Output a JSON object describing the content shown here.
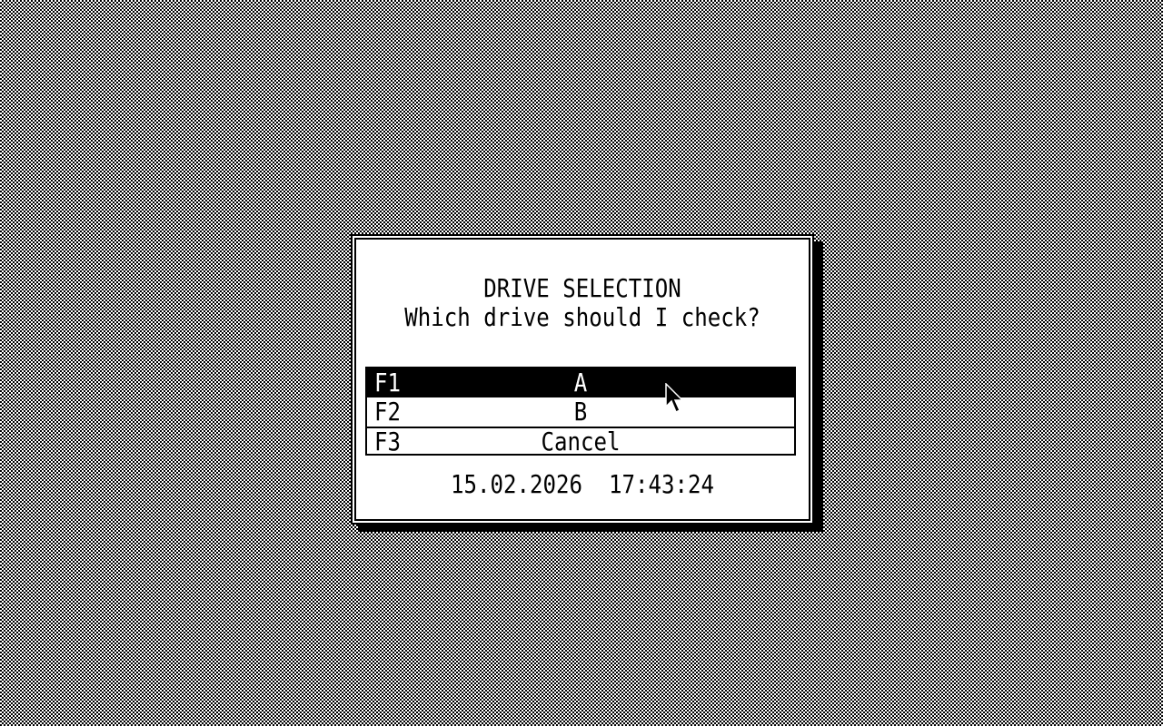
{
  "dialog": {
    "title": "DRIVE SELECTION",
    "question": "Which drive should I check?",
    "options": [
      {
        "key": "F1",
        "label": "A",
        "selected": true
      },
      {
        "key": "F2",
        "label": "B",
        "selected": false
      },
      {
        "key": "F3",
        "label": "Cancel",
        "selected": false
      }
    ],
    "date": "15.02.2026",
    "time": "17:43:24"
  },
  "icons": {
    "cursor": "mouse-pointer-icon"
  }
}
